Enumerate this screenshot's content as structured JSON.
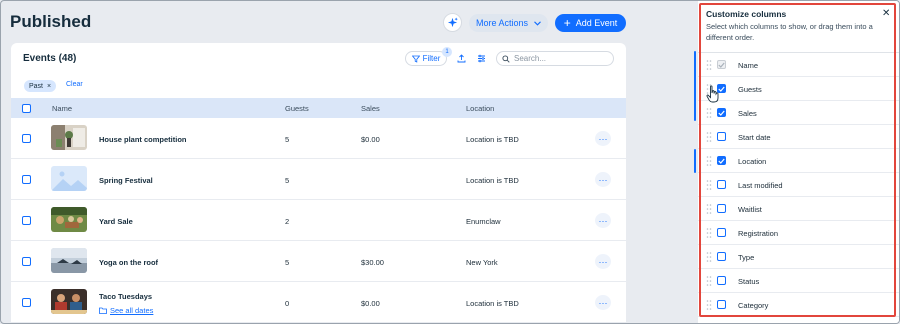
{
  "header": {
    "title": "Published",
    "more_actions_label": "More Actions",
    "add_event_label": "Add Event"
  },
  "events_card": {
    "title": "Events (48)",
    "filter_label": "Filter",
    "filter_count": "1",
    "search_placeholder": "Search...",
    "active_filter_chip": "Past",
    "clear_label": "Clear",
    "columns": {
      "name": "Name",
      "guests": "Guests",
      "sales": "Sales",
      "location": "Location"
    },
    "rows": [
      {
        "name": "House plant competition",
        "guests": "5",
        "sales": "$0.00",
        "location": "Location is TBD",
        "thumb": "plant"
      },
      {
        "name": "Spring Festival",
        "guests": "5",
        "sales": "",
        "location": "Location is TBD",
        "thumb": "placeholder"
      },
      {
        "name": "Yard Sale",
        "guests": "2",
        "sales": "",
        "location": "Enumclaw",
        "thumb": "yard"
      },
      {
        "name": "Yoga on the roof",
        "guests": "5",
        "sales": "$30.00",
        "location": "New York",
        "thumb": "roof"
      },
      {
        "name": "Taco Tuesdays",
        "sub_link": "See all dates",
        "guests": "0",
        "sales": "$0.00",
        "location": "Location is TBD",
        "thumb": "taco"
      }
    ]
  },
  "customize_panel": {
    "title": "Customize columns",
    "description": "Select which columns to show, or drag them into a different order.",
    "items": [
      {
        "label": "Name",
        "checked": true,
        "disabled": true
      },
      {
        "label": "Guests",
        "checked": true,
        "disabled": false
      },
      {
        "label": "Sales",
        "checked": true,
        "disabled": false
      },
      {
        "label": "Start date",
        "checked": false,
        "disabled": false
      },
      {
        "label": "Location",
        "checked": true,
        "disabled": false
      },
      {
        "label": "Last modified",
        "checked": false,
        "disabled": false
      },
      {
        "label": "Waitlist",
        "checked": false,
        "disabled": false
      },
      {
        "label": "Registration",
        "checked": false,
        "disabled": false
      },
      {
        "label": "Type",
        "checked": false,
        "disabled": false
      },
      {
        "label": "Status",
        "checked": false,
        "disabled": false
      },
      {
        "label": "Category",
        "checked": false,
        "disabled": false
      }
    ]
  },
  "colors": {
    "accent": "#116dff",
    "highlight_border": "#e2463c",
    "table_header": "#dae6f8"
  }
}
